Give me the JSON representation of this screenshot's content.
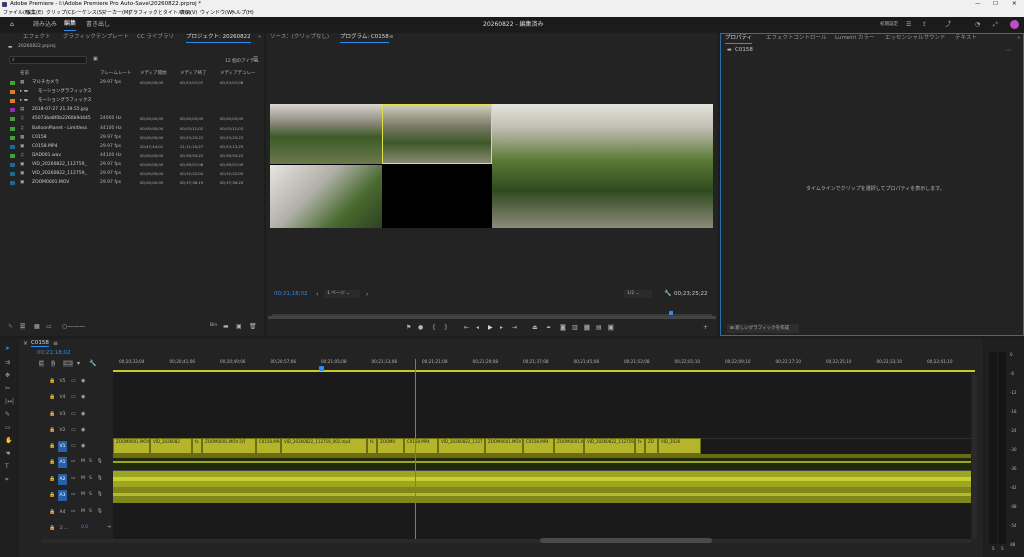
{
  "titlebar": {
    "title": "Adobe Premiere - I:\\Adobe Premiere Pro Auto-Save\\20260822.prproj *"
  },
  "menubar": {
    "items": [
      "ファイル(F)",
      "編集(E)",
      "クリップ(C)",
      "シーケンス(S)",
      "マーカー(M)",
      "グラフィックとタイトル(G)",
      "表示(V)",
      "ウィンドウ(W)",
      "ヘルプ(H)"
    ]
  },
  "appbar": {
    "tabs": [
      "読み込み",
      "編集",
      "書き出し"
    ],
    "project_title": "20260822 - 編集済み",
    "workspace": "初期設定"
  },
  "project": {
    "tabs": [
      "エフェクト",
      "グラフィックテンプレート",
      "CC ライブラリ",
      "プロジェクト: 20260822"
    ],
    "file": "20260822.prproj",
    "item_count": "12 個のアイテム",
    "headers": [
      "名前",
      "フレームレート",
      "メディア開始",
      "メディア終了",
      "メディアデュレー"
    ],
    "items": [
      {
        "name": "マルチカメラ",
        "fps": "29.97 fps",
        "start": "00;00;00;00",
        "end": "00;23;07;07",
        "dur": "00;23;07;08",
        "color": "#3fa336",
        "type": "seq"
      },
      {
        "name": "モーショングラフィックス",
        "fps": "",
        "start": "",
        "end": "",
        "dur": "",
        "color": "#e07b1f",
        "type": "folder"
      },
      {
        "name": "モーショングラフィックス",
        "fps": "",
        "start": "",
        "end": "",
        "dur": "",
        "color": "#e07b1f",
        "type": "folder"
      },
      {
        "name": "2018-07-27 21.39.55.jpg",
        "fps": "",
        "start": "",
        "end": "",
        "dur": "",
        "color": "#8a2fb4",
        "type": "img"
      },
      {
        "name": "45073ba8f0b2260b9d445",
        "fps": "24000 Hz",
        "start": "00;00;00;00",
        "end": "00;00;03;00",
        "dur": "00;00;03;00",
        "color": "#3fa336",
        "type": "aud"
      },
      {
        "name": "BalloonPlanet - Limitless",
        "fps": "44100 Hz",
        "start": "00;00;00;00",
        "end": "00;03;11;02",
        "dur": "00;03;11;03",
        "color": "#3fa336",
        "type": "aud"
      },
      {
        "name": "C0158",
        "fps": "29.97 fps",
        "start": "00;00;00;00",
        "end": "00;23;25;22",
        "dur": "00;23;25;23",
        "color": "#3fa336",
        "type": "seq"
      },
      {
        "name": "C0158.MP4",
        "fps": "29.97 fps",
        "start": "20;47;44;01",
        "end": "21;11;10;27",
        "dur": "00;23;13;25",
        "color": "#1b6a94",
        "type": "vid"
      },
      {
        "name": "DAD001.wav",
        "fps": "44100 Hz",
        "start": "00;00;00;00",
        "end": "00;30;54;22",
        "dur": "00;30;54;23",
        "color": "#3fa336",
        "type": "aud"
      },
      {
        "name": "VID_20260822_112759_",
        "fps": "29.97 fps",
        "start": "00;00;00;00",
        "end": "00;39;57;08",
        "dur": "00;39;57;09",
        "color": "#1b6a94",
        "type": "vid"
      },
      {
        "name": "VID_20260822_112759_",
        "fps": "29.97 fps",
        "start": "00;00;00;00",
        "end": "00;32;22;04",
        "dur": "00;32;22;05",
        "color": "#1b6a94",
        "type": "vid"
      },
      {
        "name": "ZOOM0001.MOV",
        "fps": "29.97 fps",
        "start": "00;00;00;00",
        "end": "00;37;36;19",
        "dur": "00;37;36;20",
        "color": "#1b6a94",
        "type": "vid"
      }
    ]
  },
  "program": {
    "tabs": [
      "ソース：(クリップなし)",
      "プログラム: C0158"
    ],
    "timecode": "00;21;18;02",
    "fit": "1 ページ",
    "resolution": "1/2",
    "duration": "00;23;25;22"
  },
  "properties": {
    "tabs": [
      "プロパティ",
      "エフェクトコントロール",
      "Lumetri カラー",
      "エッセンシャルサウンド",
      "テキスト"
    ],
    "clip": "C0158",
    "message": "タイムラインでクリップを選択してプロパティを表示します。",
    "new_graphic": "新しいグラフィックを作成"
  },
  "timeline": {
    "sequence": "C0158",
    "timecode": "00;21;18;02",
    "ruler": [
      "00;20;33;04",
      "00;20;41;06",
      "00;20;49;06",
      "00;20;57;06",
      "00;21;05;08",
      "00;21;13;08",
      "00;21;21;08",
      "00;21;29;08",
      "00;21;37;08",
      "00;21;45;08",
      "00;21;53;08",
      "00;22;01;10",
      "00;22;09;10",
      "00;22;17;10",
      "00;22;25;10",
      "00;22;33;10",
      "00;22;41;10"
    ],
    "video_tracks": [
      "V5",
      "V4",
      "V3",
      "V2",
      "V1"
    ],
    "audio_tracks": [
      "A1",
      "A2",
      "A3",
      "A4"
    ],
    "mix_label": "ミ...",
    "mix_value": "0.0",
    "v1_clips": [
      "ZOOM0001.MOV [V]",
      "VID_2026082",
      "fx",
      "ZOOM0001.MOV [V]",
      "C0158.MP4",
      "VID_20260822_112759_002.mp4",
      "fx",
      "ZOOM0",
      "C0158.MP4",
      "VID_20260822_1127",
      "ZOOM0001.MOV",
      "C0158.MP4",
      "ZOOM0001.MOV",
      "VID_20260822_112759_00",
      "fx",
      "ZO",
      "VID_2026"
    ],
    "meter_scale": [
      "0",
      "-6",
      "-12",
      "-18",
      "-24",
      "-30",
      "-36",
      "-42",
      "-48",
      "-54",
      "dB"
    ]
  }
}
